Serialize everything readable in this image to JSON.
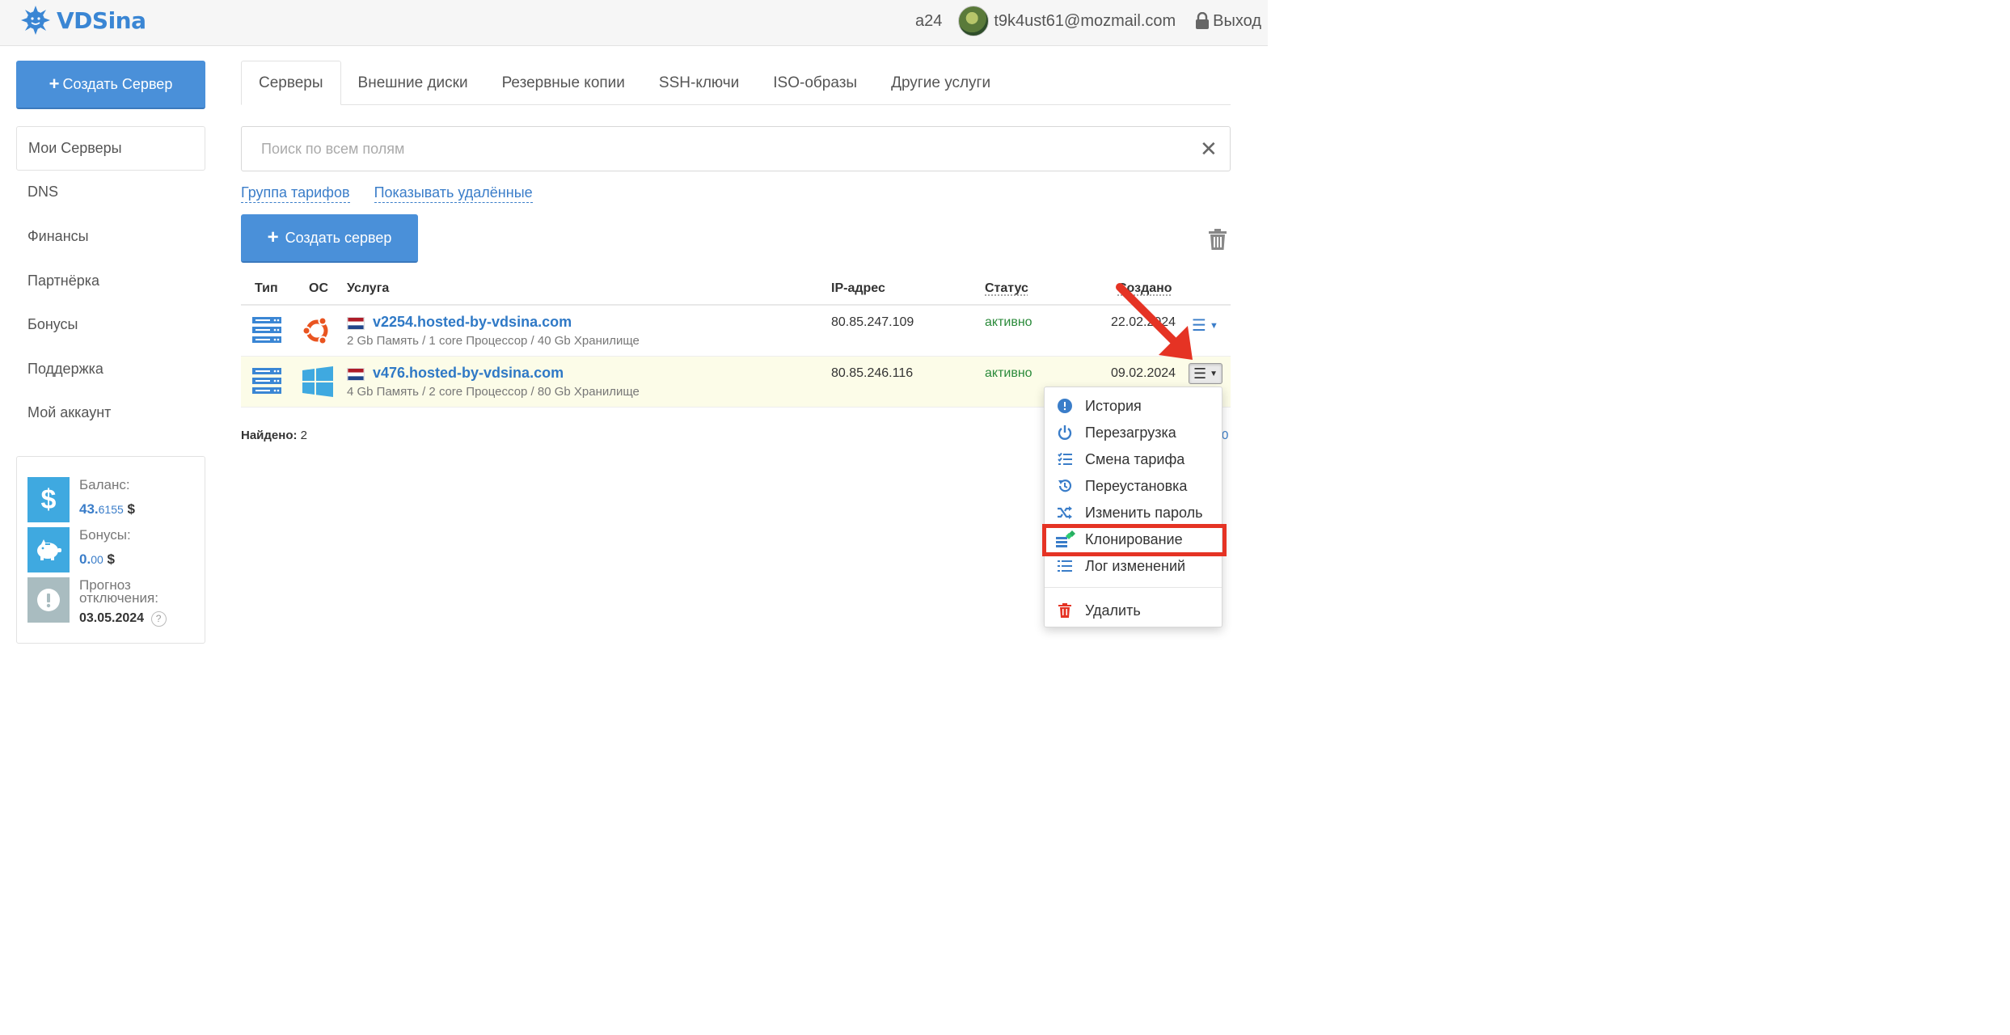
{
  "header": {
    "logo_text": "VDSina",
    "account_id": "a24",
    "email": "t9k4ust61@mozmail.com",
    "logout_label": "Выход"
  },
  "sidebar": {
    "create_button": "Создать Сервер",
    "items": [
      {
        "label": "Мои Серверы",
        "active": true
      },
      {
        "label": "DNS"
      },
      {
        "label": "Финансы"
      },
      {
        "label": "Партнёрка"
      },
      {
        "label": "Бонусы"
      },
      {
        "label": "Поддержка"
      },
      {
        "label": "Мой аккаунт"
      }
    ],
    "balance": {
      "balance_label": "Баланс:",
      "balance_int": "43.",
      "balance_frac": "6155",
      "currency": "$",
      "bonus_label": "Бонусы:",
      "bonus_int": "0.",
      "bonus_frac": "00",
      "forecast_label_1": "Прогноз",
      "forecast_label_2": "отключения:",
      "forecast_date": "03.05.2024",
      "help": "?"
    }
  },
  "tabs": [
    "Серверы",
    "Внешние диски",
    "Резервные копии",
    "SSH-ключи",
    "ISO-образы",
    "Другие услуги"
  ],
  "search": {
    "placeholder": "Поиск по всем полям",
    "clear": "✕"
  },
  "filters": {
    "tariff_group": "Группа тарифов",
    "show_deleted": "Показывать удалённые"
  },
  "main_create_button": "Создать сервер",
  "table": {
    "headers": {
      "type": "Тип",
      "os": "ОС",
      "service": "Услуга",
      "ip": "IP-адрес",
      "status": "Статус",
      "created": "Создано"
    },
    "rows": [
      {
        "name": "v2254.hosted-by-vdsina.com",
        "specs": "2 Gb Память / 1 core Процессор / 40 Gb Хранилище",
        "ip": "80.85.247.109",
        "status": "активно",
        "created": "22.02.2024",
        "os": "ubuntu"
      },
      {
        "name": "v476.hosted-by-vdsina.com",
        "specs": "4 Gb Память / 2 core Процессор / 80 Gb Хранилище",
        "ip": "80.85.246.116",
        "status": "активно",
        "created": "09.02.2024",
        "os": "windows"
      }
    ]
  },
  "found": {
    "label": "Найдено:",
    "count": "2",
    "partial": "0"
  },
  "dropdown": {
    "items": [
      {
        "label": "История",
        "icon": "exclamation-circle-icon"
      },
      {
        "label": "Перезагрузка",
        "icon": "power-icon"
      },
      {
        "label": "Смена тарифа",
        "icon": "tasks-list-icon"
      },
      {
        "label": "Переустановка",
        "icon": "history-icon"
      },
      {
        "label": "Изменить пароль",
        "icon": "shuffle-icon"
      },
      {
        "label": "Клонирование",
        "icon": "clone-server-icon"
      },
      {
        "label": "Лог изменений",
        "icon": "list-icon"
      }
    ],
    "delete_label": "Удалить"
  },
  "colors": {
    "accent": "#4a90d9",
    "link": "#2f79c6",
    "status_active": "#2a8a3a",
    "highlight_red": "#e53324"
  }
}
